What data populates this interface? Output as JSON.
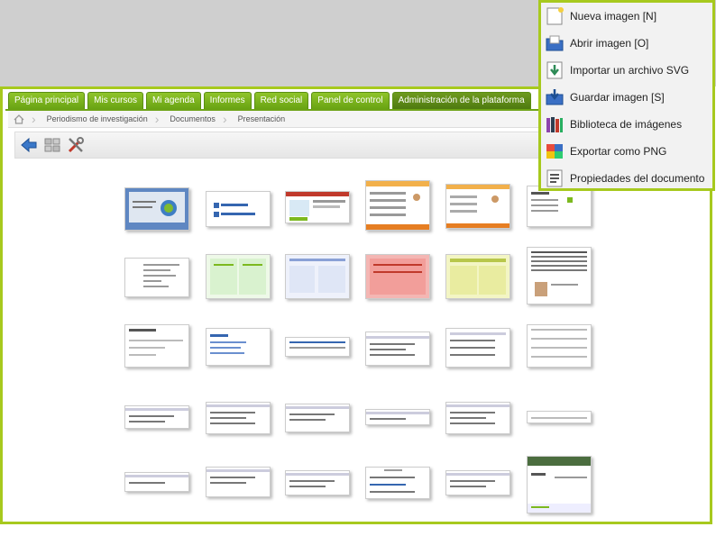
{
  "tabs": [
    {
      "label": "Página principal",
      "active": false
    },
    {
      "label": "Mis cursos",
      "active": false
    },
    {
      "label": "Mi agenda",
      "active": false
    },
    {
      "label": "Informes",
      "active": false
    },
    {
      "label": "Red social",
      "active": false
    },
    {
      "label": "Panel de control",
      "active": false
    },
    {
      "label": "Administración de la plataforma",
      "active": true
    }
  ],
  "breadcrumb": [
    "Periodismo de investigación",
    "Documentos",
    "Presentación"
  ],
  "toolbar": {
    "icons": [
      "back-arrow-icon",
      "grid-view-icon",
      "tools-icon"
    ]
  },
  "menu": {
    "items": [
      {
        "label": "Nueva imagen [N]",
        "icon": "new-image-icon"
      },
      {
        "label": "Abrir imagen [O]",
        "icon": "open-folder-icon"
      },
      {
        "label": "Importar un archivo SVG",
        "icon": "import-svg-icon"
      },
      {
        "label": "Guardar imagen [S]",
        "icon": "save-image-icon"
      },
      {
        "label": "Biblioteca de imágenes",
        "icon": "library-icon"
      },
      {
        "label": "Exportar como PNG",
        "icon": "export-png-icon"
      },
      {
        "label": "Propiedades del documento",
        "icon": "document-properties-icon"
      }
    ]
  },
  "colors": {
    "accent": "#a7c91e",
    "tab": "#7cb91f",
    "tab_active": "#5b8716"
  }
}
